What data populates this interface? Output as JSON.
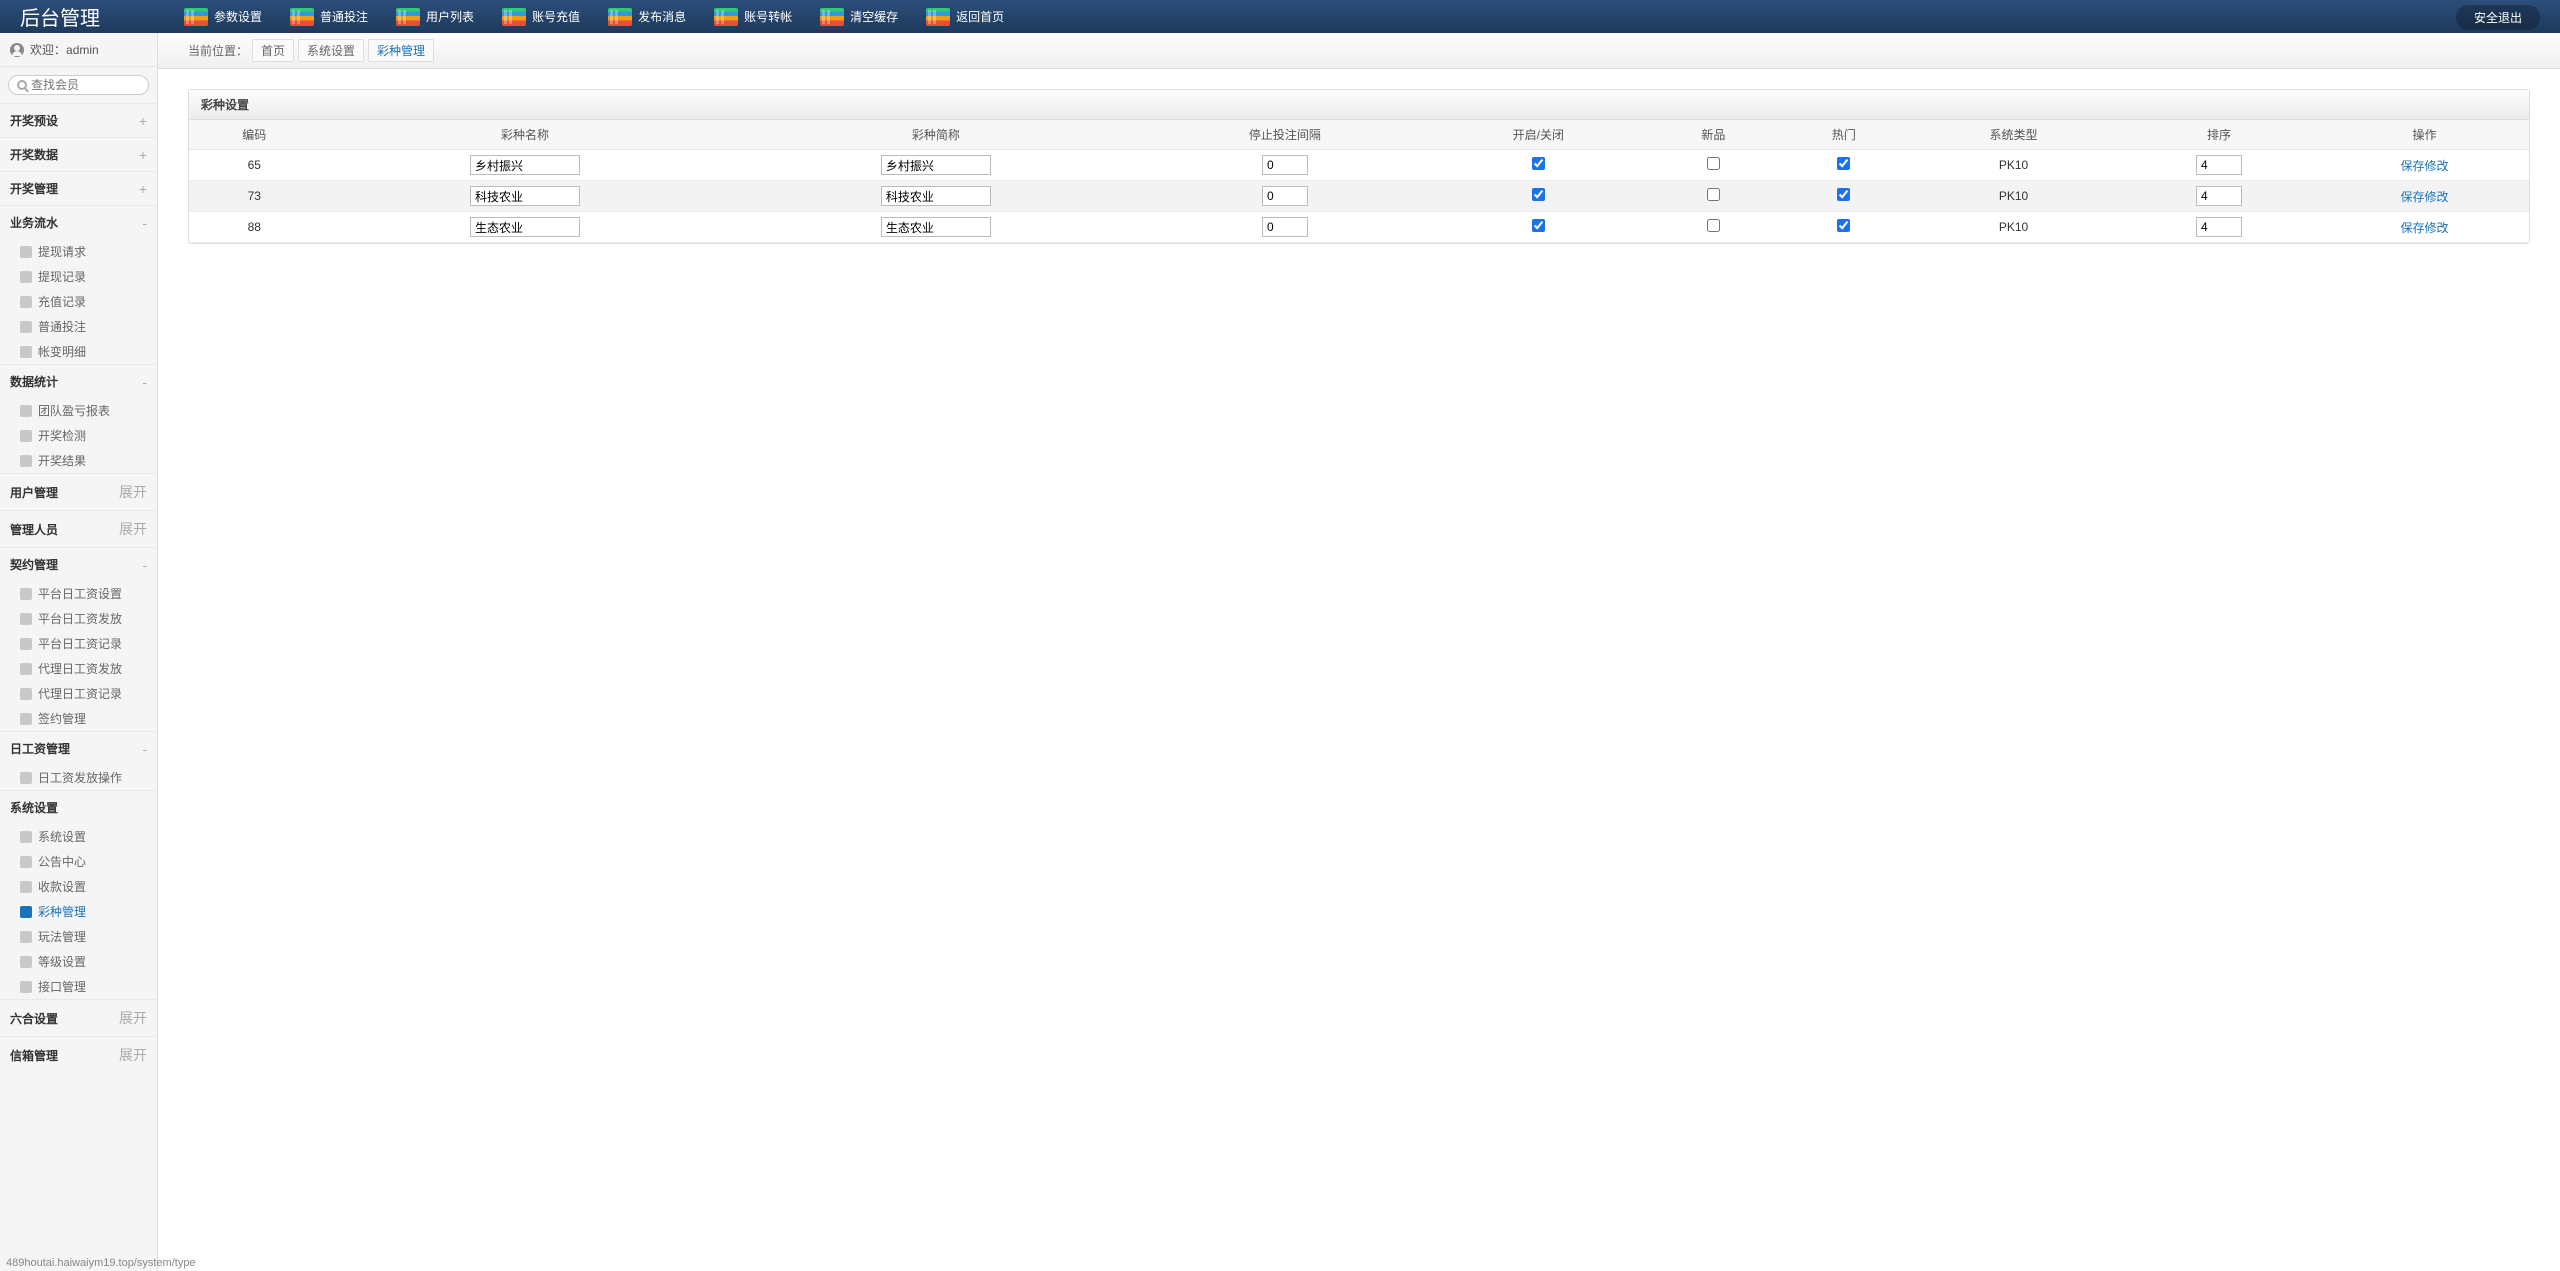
{
  "header": {
    "logo": "后台管理",
    "nav": [
      {
        "label": "参数设置"
      },
      {
        "label": "普通投注"
      },
      {
        "label": "用户列表"
      },
      {
        "label": "账号充值"
      },
      {
        "label": "发布消息"
      },
      {
        "label": "账号转帐"
      },
      {
        "label": "清空缓存"
      },
      {
        "label": "返回首页"
      }
    ],
    "logout": "安全退出"
  },
  "sidebar": {
    "welcome_label": "欢迎：",
    "username": "admin",
    "search_placeholder": "查找会员",
    "groups": [
      {
        "title": "开奖预设",
        "toggle": "+",
        "items": []
      },
      {
        "title": "开奖数据",
        "toggle": "+",
        "items": []
      },
      {
        "title": "开奖管理",
        "toggle": "+",
        "items": []
      },
      {
        "title": "业务流水",
        "toggle": "-",
        "items": [
          "提现请求",
          "提现记录",
          "充值记录",
          "普通投注",
          "帐变明细"
        ]
      },
      {
        "title": "数据统计",
        "toggle": "-",
        "items": [
          "团队盈亏报表",
          "开奖检测",
          "开奖结果"
        ]
      },
      {
        "title": "用户管理",
        "toggle": "展开",
        "items": []
      },
      {
        "title": "管理人员",
        "toggle": "展开",
        "items": []
      },
      {
        "title": "契约管理",
        "toggle": "-",
        "items": [
          "平台日工资设置",
          "平台日工资发放",
          "平台日工资记录",
          "代理日工资发放",
          "代理日工资记录",
          "签约管理"
        ]
      },
      {
        "title": "日工资管理",
        "toggle": "-",
        "items": [
          "日工资发放操作"
        ]
      },
      {
        "title": "系统设置",
        "toggle": "",
        "items": [
          "系统设置",
          "公告中心",
          "收款设置",
          "彩种管理",
          "玩法管理",
          "等级设置",
          "接口管理"
        ],
        "active": "彩种管理"
      },
      {
        "title": "六合设置",
        "toggle": "展开",
        "items": []
      },
      {
        "title": "信箱管理",
        "toggle": "展开",
        "items": []
      }
    ]
  },
  "breadcrumb": {
    "prefix": "当前位置：",
    "items": [
      "首页",
      "系统设置",
      "彩种管理"
    ]
  },
  "panel": {
    "title": "彩种设置",
    "columns": [
      "编码",
      "彩种名称",
      "彩种简称",
      "停止投注间隔",
      "开启/关闭",
      "新品",
      "热门",
      "系统类型",
      "排序",
      "操作"
    ],
    "rows": [
      {
        "code": "65",
        "name": "乡村振兴",
        "short": "乡村振兴",
        "stop": "0",
        "open": true,
        "new": false,
        "hot": true,
        "type": "PK10",
        "sort": "4",
        "action": "保存修改"
      },
      {
        "code": "73",
        "name": "科技农业",
        "short": "科技农业",
        "stop": "0",
        "open": true,
        "new": false,
        "hot": true,
        "type": "PK10",
        "sort": "4",
        "action": "保存修改"
      },
      {
        "code": "88",
        "name": "生态农业",
        "short": "生态农业",
        "stop": "0",
        "open": true,
        "new": false,
        "hot": true,
        "type": "PK10",
        "sort": "4",
        "action": "保存修改"
      }
    ]
  },
  "statusbar": "489houtai.haiwaiym19.top/system/type"
}
